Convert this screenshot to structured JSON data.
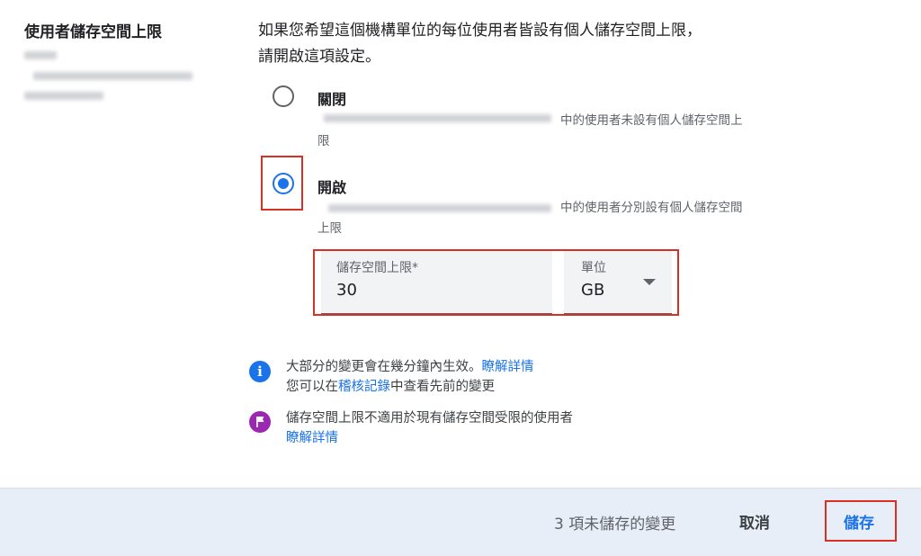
{
  "setting": {
    "title": "使用者儲存空間上限",
    "description_line1": "如果您希望這個機構單位的每位使用者皆設有個人儲存空間上限，",
    "description_line2": "請開啟這項設定。"
  },
  "options": [
    {
      "label": "關閉",
      "desc_tail": "中的使用者未設有個人儲存空間上",
      "desc_line2": "限",
      "selected": false
    },
    {
      "label": "開啟",
      "desc_tail": "中的使用者分別設有個人儲存空間",
      "desc_line2": "上限",
      "selected": true
    }
  ],
  "limit_field": {
    "label": "儲存空間上限*",
    "value": "30"
  },
  "unit_field": {
    "label": "單位",
    "value": "GB"
  },
  "notes": {
    "info_text": "大部分的變更會在幾分鐘內生效。",
    "info_link": "瞭解詳情",
    "audit_prefix": "您可以在",
    "audit_link": "稽核記錄",
    "audit_suffix": "中查看先前的變更",
    "flag_text": "儲存空間上限不適用於現有儲存空間受限的使用者",
    "flag_link": "瞭解詳情"
  },
  "footer": {
    "unsaved": "3 項未儲存的變更",
    "cancel": "取消",
    "save": "儲存"
  },
  "colors": {
    "accent": "#1a73e8",
    "highlight": "#d93025",
    "footer_bg": "#e8eef7",
    "info_icon": "#1a73e8",
    "flag_icon": "#9c27b0"
  },
  "icons": {
    "info": "info-icon",
    "flag": "flag-icon",
    "dropdown": "dropdown-arrow-icon"
  }
}
